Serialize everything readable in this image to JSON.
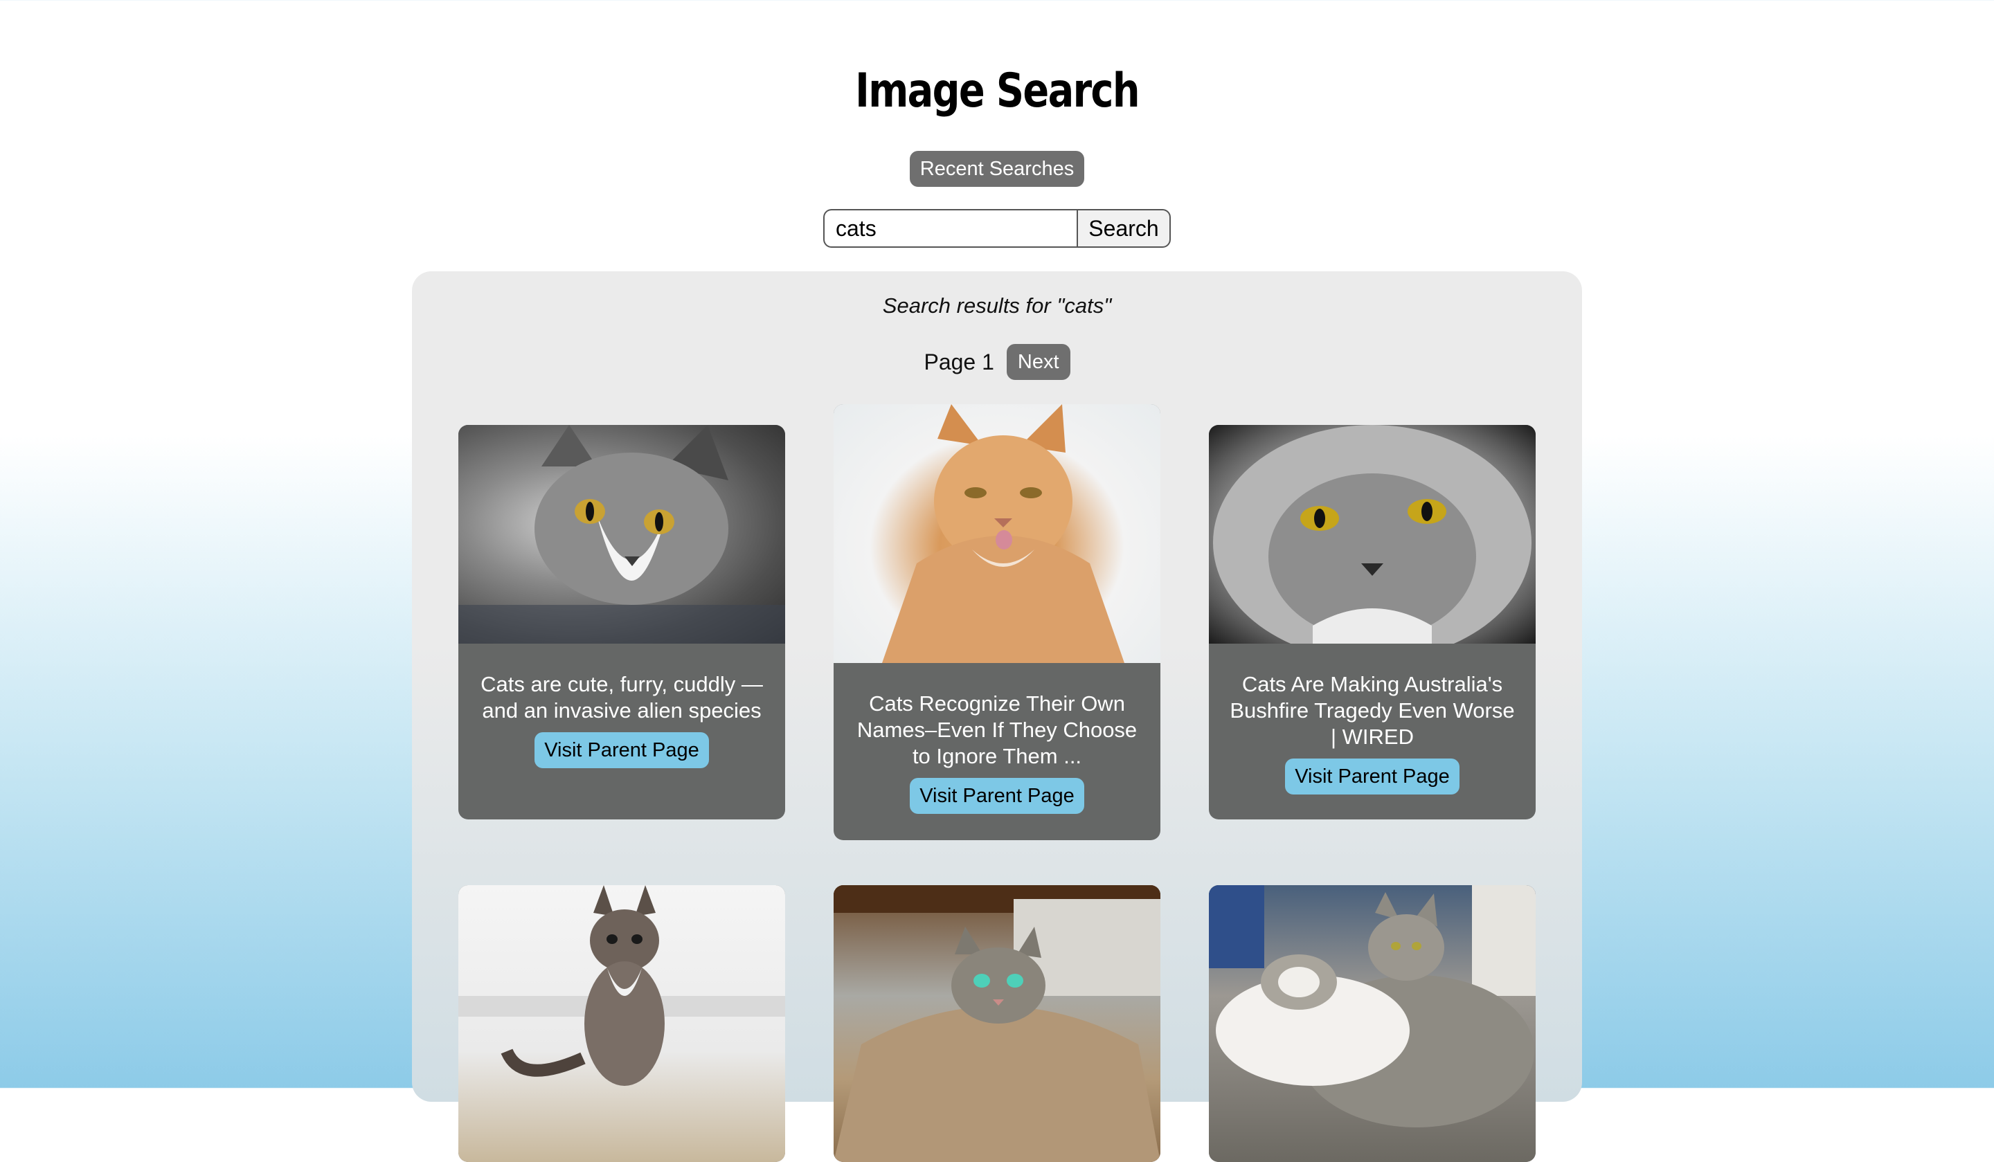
{
  "header": {
    "title": "Image Search",
    "recent_label": "Recent Searches"
  },
  "search": {
    "value": "cats",
    "button_label": "Search"
  },
  "results": {
    "heading": "Search results for \"cats\"",
    "page_label": "Page 1",
    "next_label": "Next",
    "visit_label": "Visit Parent Page",
    "cards": [
      {
        "caption": "Cats are cute, furry, cuddly — and an invasive alien species"
      },
      {
        "caption": "Cats Recognize Their Own Names–Even If They Choose to Ignore Them ..."
      },
      {
        "caption": "Cats Are Making Australia's Bushfire Tragedy Even Worse | WIRED"
      },
      {
        "caption": ""
      },
      {
        "caption": ""
      },
      {
        "caption": ""
      }
    ]
  },
  "colors": {
    "button_gray": "#6f6f6f",
    "visit_blue": "#7dc8e6",
    "card_gray": "#656766"
  }
}
